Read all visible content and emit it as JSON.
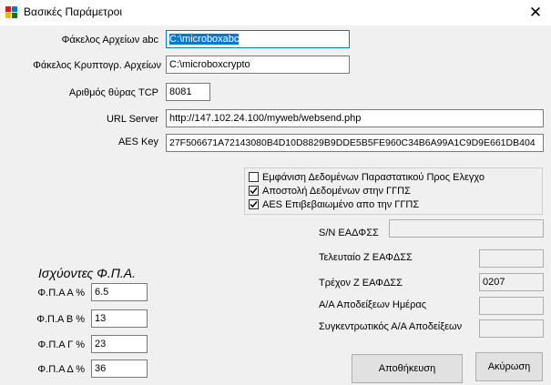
{
  "window": {
    "title": "Βασικές Παράμετροι",
    "close_glyph": "✕",
    "icon": "app-grid-icon",
    "icon_colors": [
      "#e81123",
      "#0078d7",
      "#ffb900",
      "#107c10"
    ]
  },
  "settings": {
    "folder_abc": {
      "label": "Φάκελος Αρχείων abc",
      "value": "C:\\microboxabc"
    },
    "folder_crypto": {
      "label": "Φάκελος Κρυπτογρ. Αρχείων",
      "value": "C:\\microboxcrypto"
    },
    "tcp_port": {
      "label": "Αριθμός θύρας TCP",
      "value": "8081"
    },
    "url_server": {
      "label": "URL Server",
      "value": "http://147.102.24.100/myweb/websend.php"
    },
    "aes_key": {
      "label": "AES Key",
      "value": "27F506671A72143080B4D10D8829B9DDE5B5FE960C34B6A99A1C9D9E661DB404"
    }
  },
  "options": [
    {
      "label": "Εμφάνιση Δεδομένων Παραστατικού Προς Ελεγχο",
      "checked": false
    },
    {
      "label": "Αποστολή Δεδομένων στην ΓΓΠΣ",
      "checked": true
    },
    {
      "label": "AES Επιβεβαιωμένο απο την ΓΓΠΣ",
      "checked": true
    }
  ],
  "device": {
    "sn": {
      "label": "S/N ΕΑΔΦΣΣ",
      "value": ""
    },
    "last_z": {
      "label": "Τελευταίο  Ζ ΕΑΦΔΣΣ",
      "value": ""
    },
    "current_z": {
      "label": "Τρέχον Ζ ΕΑΦΔΣΣ",
      "value": "0207"
    },
    "receipts_day": {
      "label": "Α/Α Αποδείξεων Ημέρας",
      "value": ""
    },
    "receipts_total": {
      "label": "Συγκεντρωτικός Α/Α Αποδείξεων",
      "value": ""
    }
  },
  "vat": {
    "title": "Ισχύοντες Φ.Π.Α.",
    "rates": [
      {
        "label": "Φ.Π.Α Α %",
        "value": "6.5"
      },
      {
        "label": "Φ.Π.Α Β %",
        "value": "13"
      },
      {
        "label": "Φ.Π.Α Γ %",
        "value": "23"
      },
      {
        "label": "Φ.Π.Α Δ %",
        "value": "36"
      }
    ]
  },
  "buttons": {
    "save": "Αποθήκευση",
    "cancel": "Ακύρωση"
  }
}
